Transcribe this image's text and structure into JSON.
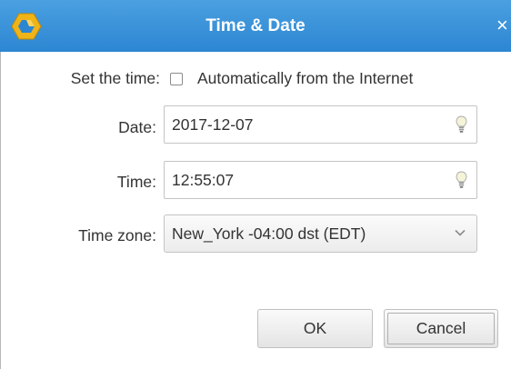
{
  "window": {
    "title": "Time & Date",
    "close_glyph": "×",
    "logo_icon": "app-logo-icon"
  },
  "form": {
    "set_time_label": "Set the time:",
    "auto_checkbox": {
      "label": "Automatically from the Internet",
      "checked": false
    },
    "date": {
      "label": "Date:",
      "value": "2017-12-07",
      "icon": "lightbulb-icon"
    },
    "time": {
      "label": "Time:",
      "value": "12:55:07",
      "icon": "lightbulb-icon"
    },
    "timezone": {
      "label": "Time zone:",
      "value": "New_York -04:00 dst (EDT)",
      "icon": "chevron-down-icon"
    }
  },
  "buttons": {
    "ok": "OK",
    "cancel": "Cancel"
  },
  "colors": {
    "titlebar": "#2d86d2",
    "logo": "#f0b419",
    "text": "#333333"
  }
}
